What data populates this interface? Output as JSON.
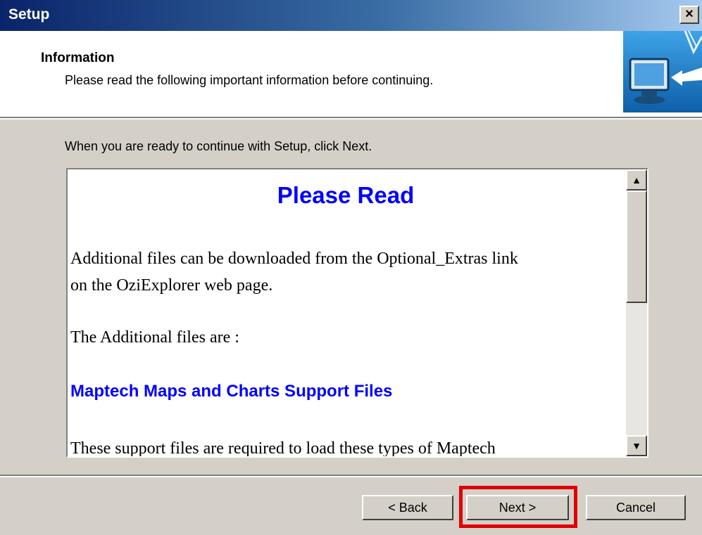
{
  "window": {
    "title": "Setup",
    "close_label": "×"
  },
  "header": {
    "title": "Information",
    "subtitle": "Please read the following important information before continuing."
  },
  "lead_text": "When you are ready to continue with Setup, click Next.",
  "info": {
    "heading": "Please Read",
    "para1_line1": "Additional files can be downloaded from the Optional_Extras link",
    "para1_line2": "on the OziExplorer web page.",
    "para2": "The Additional files are :",
    "section_heading": "Maptech Maps and Charts Support Files",
    "para3_partial": "These support files are required to load these types of Maptech"
  },
  "scroll": {
    "up": "▲",
    "down": "▼"
  },
  "buttons": {
    "back": "< Back",
    "next": "Next >",
    "cancel": "Cancel"
  },
  "colors": {
    "link_blue": "#0000ff",
    "highlight": "#e00000",
    "title_gradient_start": "#0a246a"
  }
}
